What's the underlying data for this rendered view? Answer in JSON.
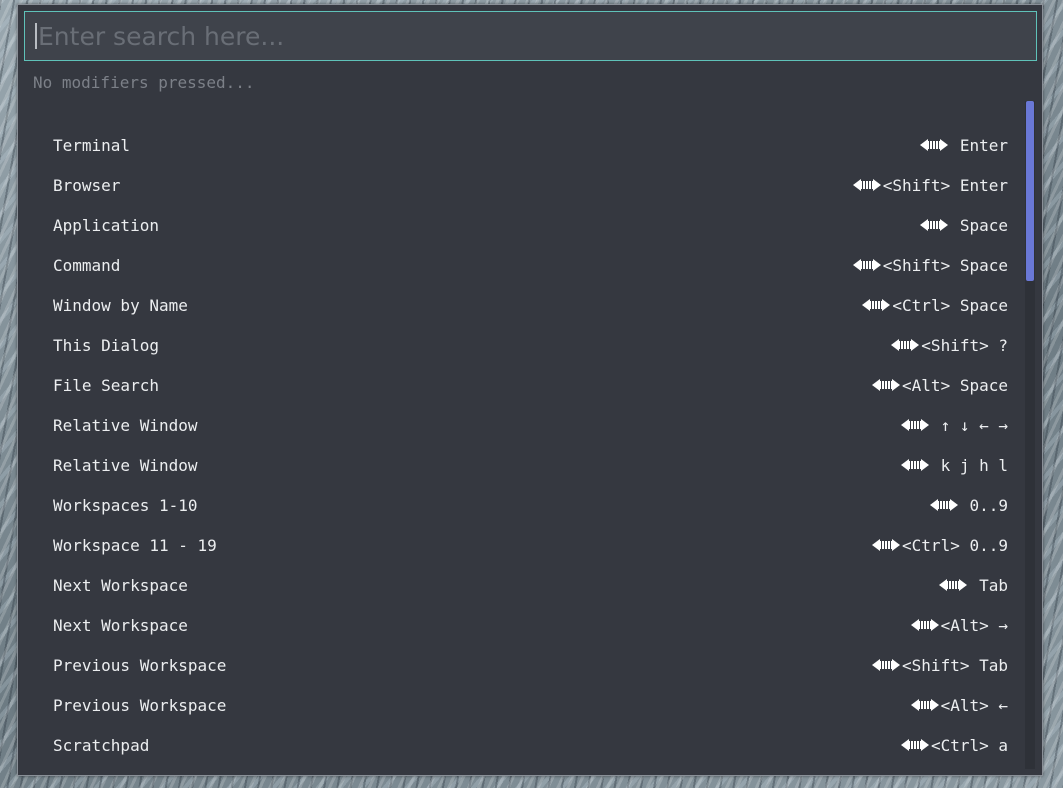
{
  "search": {
    "placeholder": "Enter search here...",
    "value": ""
  },
  "status": "No modifiers pressed...",
  "scroll": {
    "thumb_fraction": 0.27,
    "position": 0
  },
  "rows": [
    {
      "name": "Terminal",
      "keys": " Enter"
    },
    {
      "name": "Browser",
      "keys": "<Shift> Enter"
    },
    {
      "name": "Application",
      "keys": " Space"
    },
    {
      "name": "Command",
      "keys": "<Shift> Space"
    },
    {
      "name": "Window by Name",
      "keys": "<Ctrl> Space"
    },
    {
      "name": "This Dialog",
      "keys": "<Shift> ?"
    },
    {
      "name": "File Search",
      "keys": "<Alt> Space"
    },
    {
      "name": "Relative Window",
      "keys": " ↑ ↓ ← →"
    },
    {
      "name": "Relative Window",
      "keys": " k j h l"
    },
    {
      "name": "Workspaces 1-10",
      "keys": " 0..9"
    },
    {
      "name": "Workspace 11 - 19",
      "keys": "<Ctrl> 0..9"
    },
    {
      "name": "Next Workspace",
      "keys": " Tab"
    },
    {
      "name": "Next Workspace",
      "keys": "<Alt> →"
    },
    {
      "name": "Previous Workspace",
      "keys": "<Shift> Tab"
    },
    {
      "name": "Previous Workspace",
      "keys": "<Alt> ←"
    },
    {
      "name": "Scratchpad",
      "keys": "<Ctrl> a"
    }
  ],
  "colors": {
    "accent_border": "#5fc2b9",
    "scroll_thumb": "#6a78d6",
    "panel_bg": "#353840"
  },
  "icons": {
    "modifier_key": "regolith-logo-icon"
  }
}
